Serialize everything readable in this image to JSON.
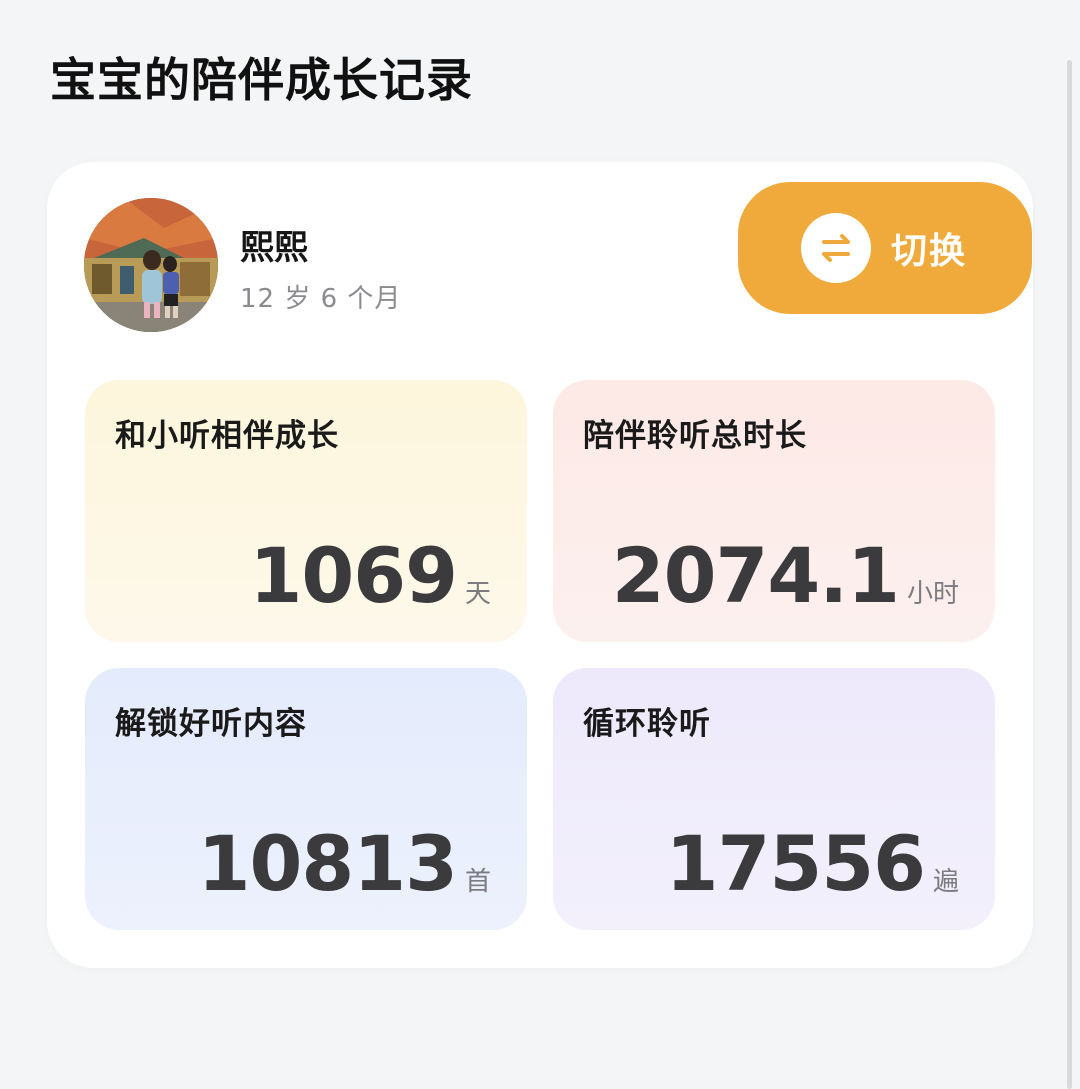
{
  "page": {
    "title": "宝宝的陪伴成长记录"
  },
  "profile": {
    "name": "熙熙",
    "age": "12 岁 6 个月",
    "avatar_icon": "child-photo-avatar"
  },
  "switch_button": {
    "label": "切换",
    "icon": "swap-arrows-icon",
    "color": "#f0aa3c"
  },
  "stats": [
    {
      "label": "和小听相伴成长",
      "value": "1069",
      "unit": "天",
      "color": "#fdf6dc"
    },
    {
      "label": "陪伴聆听总时长",
      "value": "2074.1",
      "unit": "小时",
      "color": "#fde9e6"
    },
    {
      "label": "解锁好听内容",
      "value": "10813",
      "unit": "首",
      "color": "#e4ebfc"
    },
    {
      "label": "循环聆听",
      "value": "17556",
      "unit": "遍",
      "color": "#ede9fb"
    }
  ]
}
